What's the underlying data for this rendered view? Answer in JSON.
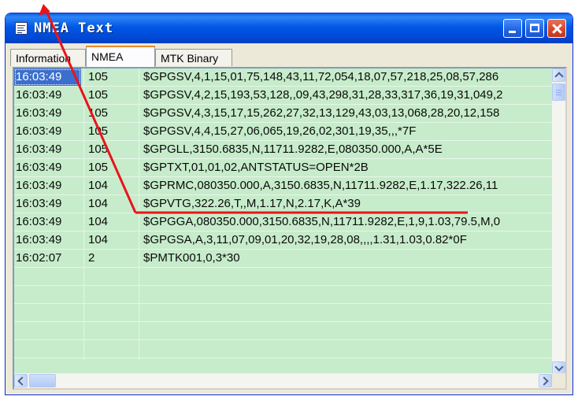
{
  "window": {
    "title": "NMEA Text",
    "icon": "document-icon",
    "controls": [
      "minimize-icon",
      "maximize-icon",
      "close-icon"
    ],
    "titlebar_color": "#0054e3"
  },
  "tabs": [
    {
      "label": "Information",
      "active": false
    },
    {
      "label": "NMEA",
      "active": true
    },
    {
      "label": "MTK Binary",
      "active": false
    }
  ],
  "grid": {
    "background": "#c7eccb",
    "selected_color": "#3b6fcd",
    "rows": [
      {
        "time": "16:03:49",
        "id": "105",
        "message": "$GPGSV,4,1,15,01,75,148,43,11,72,054,18,07,57,218,25,08,57,286"
      },
      {
        "time": "16:03:49",
        "id": "105",
        "message": "$GPGSV,4,2,15,193,53,128,,09,43,298,31,28,33,317,36,19,31,049,2"
      },
      {
        "time": "16:03:49",
        "id": "105",
        "message": "$GPGSV,4,3,15,17,15,262,27,32,13,129,43,03,13,068,28,20,12,158"
      },
      {
        "time": "16:03:49",
        "id": "105",
        "message": "$GPGSV,4,4,15,27,06,065,19,26,02,301,19,35,,,*7F"
      },
      {
        "time": "16:03:49",
        "id": "105",
        "message": "$GPGLL,3150.6835,N,11711.9282,E,080350.000,A,A*5E"
      },
      {
        "time": "16:03:49",
        "id": "105",
        "message": "$GPTXT,01,01,02,ANTSTATUS=OPEN*2B"
      },
      {
        "time": "16:03:49",
        "id": "104",
        "message": "$GPRMC,080350.000,A,3150.6835,N,11711.9282,E,1.17,322.26,11"
      },
      {
        "time": "16:03:49",
        "id": "104",
        "message": "$GPVTG,322.26,T,,M,1.17,N,2.17,K,A*39"
      },
      {
        "time": "16:03:49",
        "id": "104",
        "message": "$GPGGA,080350.000,3150.6835,N,11711.9282,E,1,9,1.03,79.5,M,0"
      },
      {
        "time": "16:03:49",
        "id": "104",
        "message": "$GPGSA,A,3,11,07,09,01,20,32,19,28,08,,,,1.31,1.03,0.82*0F"
      },
      {
        "time": "16:02:07",
        "id": "2",
        "message": "$PMTK001,0,3*30"
      },
      {
        "time": "",
        "id": "",
        "message": ""
      },
      {
        "time": "",
        "id": "",
        "message": ""
      },
      {
        "time": "",
        "id": "",
        "message": ""
      },
      {
        "time": "",
        "id": "",
        "message": ""
      },
      {
        "time": "",
        "id": "",
        "message": ""
      }
    ],
    "selected_row": 0
  },
  "annotation": {
    "color": "#e8141b"
  }
}
